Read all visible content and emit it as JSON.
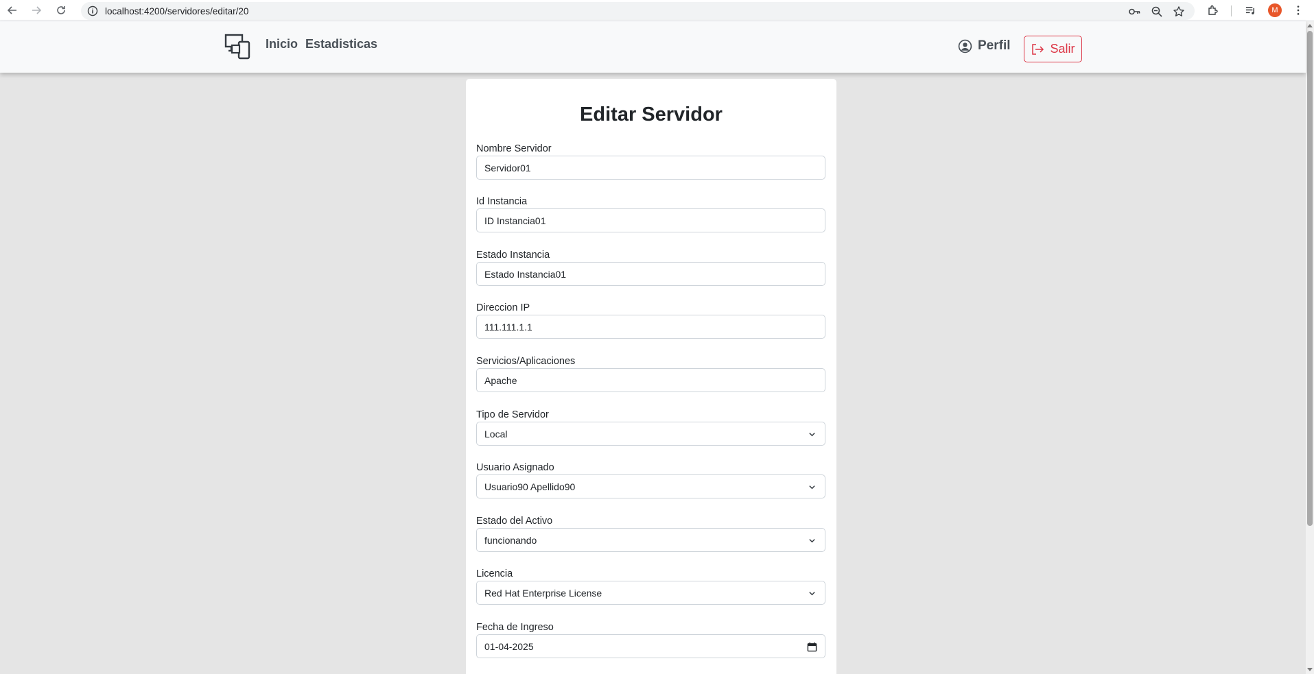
{
  "browser": {
    "url": "localhost:4200/servidores/editar/20",
    "profile_initial": "M"
  },
  "navbar": {
    "inicio": "Inicio",
    "estadisticas": "Estadisticas",
    "perfil": "Perfil",
    "salir": "Salir"
  },
  "form": {
    "title": "Editar Servidor",
    "fields": [
      {
        "label": "Nombre Servidor",
        "value": "Servidor01",
        "type": "text"
      },
      {
        "label": "Id Instancia",
        "value": "ID Instancia01",
        "type": "text"
      },
      {
        "label": "Estado Instancia",
        "value": "Estado Instancia01",
        "type": "text"
      },
      {
        "label": "Direccion IP",
        "value": "111.111.1.1",
        "type": "text"
      },
      {
        "label": "Servicios/Aplicaciones",
        "value": "Apache",
        "type": "text"
      },
      {
        "label": "Tipo de Servidor",
        "value": "Local",
        "type": "select"
      },
      {
        "label": "Usuario Asignado",
        "value": "Usuario90 Apellido90",
        "type": "select"
      },
      {
        "label": "Estado del Activo",
        "value": "funcionando",
        "type": "select"
      },
      {
        "label": "Licencia",
        "value": "Red Hat Enterprise License",
        "type": "select"
      },
      {
        "label": "Fecha de Ingreso",
        "value": "01-04-2025",
        "type": "date"
      }
    ]
  },
  "colors": {
    "danger": "#dc3545",
    "background": "#e5e5e5",
    "navbar": "#f8f9fa"
  }
}
